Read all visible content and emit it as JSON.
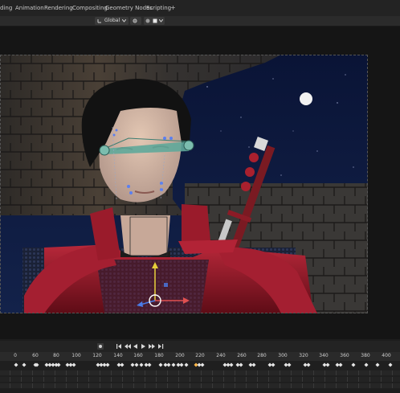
{
  "workspace_tabs": [
    "ding",
    "Animation",
    "Rendering",
    "Compositing",
    "Geometry Nodes",
    "Scripting"
  ],
  "add_tab_label": "+",
  "viewport_header": {
    "orientation_label": "Global",
    "orientation_icon": "transform-orientation-icon",
    "dropdown_icon": "chevron-down-icon",
    "pivot_icon": "pivot-point-icon",
    "snap_icon": "snap-icon",
    "proportional_icon": "proportional-editing-icon"
  },
  "playback_controls": {
    "record_icon": "record-icon",
    "buttons": [
      "jump-start-icon",
      "prev-keyframe-icon",
      "play-reverse-icon",
      "play-icon",
      "next-keyframe-icon",
      "jump-end-icon"
    ]
  },
  "timeline_ruler": [
    "60",
    "80",
    "100",
    "120",
    "140",
    "160",
    "180",
    "200",
    "220",
    "240",
    "260",
    "280",
    "300",
    "320",
    "340",
    "360",
    "380",
    "400",
    "420"
  ],
  "timeline_ruler_partial": "0",
  "colors": {
    "keyframe": "#e6e6e6",
    "selected_keyframe": "#ffb84a",
    "armor_red": "#8a1320",
    "bone_teal": "#4fb3a0",
    "night_sky": "#0b1533"
  }
}
